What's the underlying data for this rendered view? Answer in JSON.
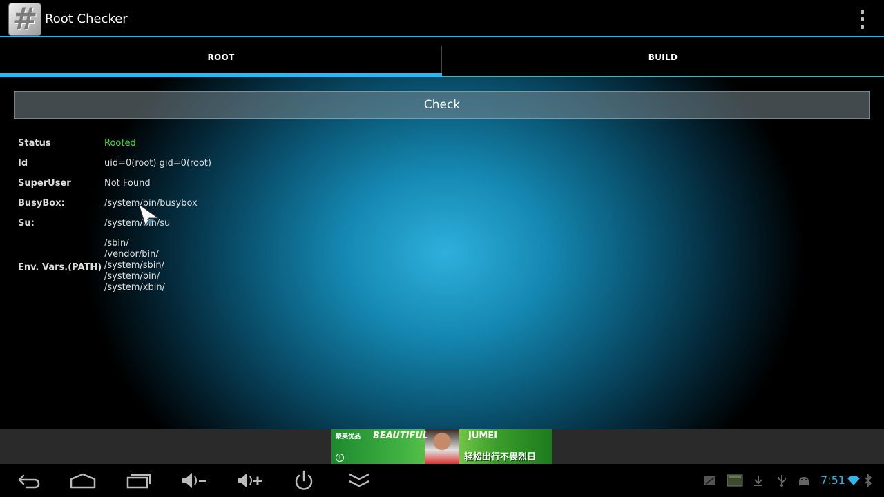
{
  "app": {
    "title": "Root Checker",
    "icon_glyph": "#",
    "icon": "hash-app-icon"
  },
  "action_bar": {
    "overflow_icon": "overflow-menu-icon"
  },
  "tabs": [
    {
      "label": "ROOT",
      "active": true
    },
    {
      "label": "BUILD",
      "active": false
    }
  ],
  "check_button": {
    "label": "Check"
  },
  "info": {
    "status": {
      "label": "Status",
      "value": "Rooted",
      "color": "#3ee63e"
    },
    "id": {
      "label": "Id",
      "value": "uid=0(root) gid=0(root)"
    },
    "superuser": {
      "label": "SuperUser",
      "value": "Not Found"
    },
    "busybox": {
      "label": "BusyBox:",
      "value": "/system/bin/busybox"
    },
    "su": {
      "label": "Su:",
      "value": "/system/bin/su"
    },
    "env_path": {
      "label": "Env. Vars.(PATH)",
      "values": [
        "/sbin/",
        "/vendor/bin/",
        "/system/sbin/",
        "/system/bin/",
        "/system/xbin/"
      ]
    }
  },
  "ad": {
    "logo_text": "聚美优品",
    "headline": "BEAUTIFUL",
    "brand": "JUMEI",
    "slogan": "轻松出行不畏烈日"
  },
  "system_nav": {
    "buttons": [
      "back-icon",
      "home-icon",
      "recent-apps-icon",
      "volume-down-icon",
      "volume-up-icon",
      "power-icon",
      "collapse-icon"
    ]
  },
  "status_bar": {
    "time": "7:51",
    "icons": [
      "screenshot-icon",
      "sd-card-icon",
      "download-icon",
      "usb-icon",
      "android-debug-icon",
      "wifi-icon",
      "bluetooth-icon"
    ]
  },
  "colors": {
    "accent": "#33b5e5",
    "rooted": "#3ee63e"
  }
}
